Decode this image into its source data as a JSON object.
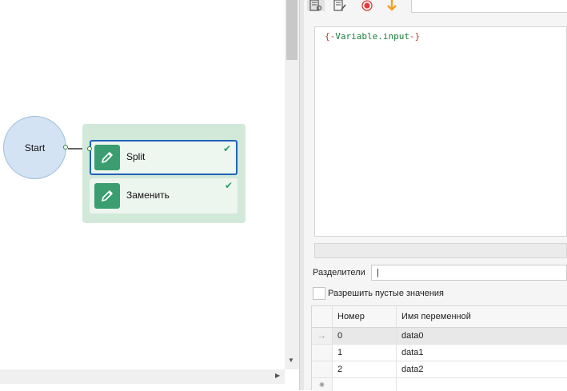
{
  "canvas": {
    "start_label": "Start",
    "actions": [
      {
        "label": "Split",
        "selected": true
      },
      {
        "label": "Заменить",
        "selected": false
      }
    ],
    "colors": {
      "start_fill": "#d3e3f3",
      "group_fill": "#d2e9d9",
      "action_icon": "#3a9e71",
      "selection": "#1f63b8",
      "check": "#2a9d6a"
    }
  },
  "toolbar": {
    "icons": [
      "properties-icon",
      "edit-document-icon",
      "record-icon",
      "arrow-down-icon"
    ]
  },
  "editor": {
    "open_brace": "{-",
    "variable_text": "Variable.input",
    "close_brace": "-}"
  },
  "form": {
    "separators_label": "Разделители",
    "separators_value": "|",
    "allow_empty_label": "Разрешить пустые значения",
    "allow_empty_checked": false
  },
  "grid": {
    "columns": [
      "Номер",
      "Имя переменной"
    ],
    "rows": [
      {
        "indicator": "→",
        "num": "0",
        "name": "data0"
      },
      {
        "indicator": "",
        "num": "1",
        "name": "data1"
      },
      {
        "indicator": "",
        "num": "2",
        "name": "data2"
      }
    ],
    "new_row_indicator": "✷"
  }
}
